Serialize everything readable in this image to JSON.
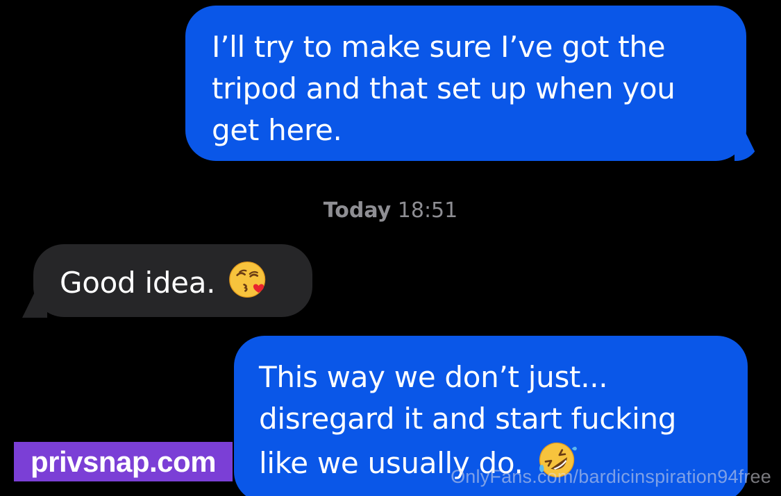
{
  "thread": {
    "messages": [
      {
        "direction": "sent",
        "text": "I’ll try to make sure I’ve got the\ntripod and that set up when you\nget here."
      },
      {
        "direction": "received",
        "text": "Good idea.",
        "emoji": "face-blowing-kiss-emoji"
      },
      {
        "direction": "sent",
        "text": "This way we don’t just...\ndisregard it and start fucking\nlike we usually do.",
        "emoji": "rolling-on-floor-laughing-emoji"
      }
    ],
    "timestamp": {
      "day": "Today",
      "time": "18:51"
    }
  },
  "overlays": {
    "site_label": "privsnap.com",
    "watermark": "OnlyFans.com/bardicinspiration94free"
  },
  "colors": {
    "background": "#000000",
    "sent_bubble": "#0a57e8",
    "received_bubble": "#262628",
    "timestamp_text": "#8e8e93",
    "site_label_bg": "#7b3fd6"
  }
}
